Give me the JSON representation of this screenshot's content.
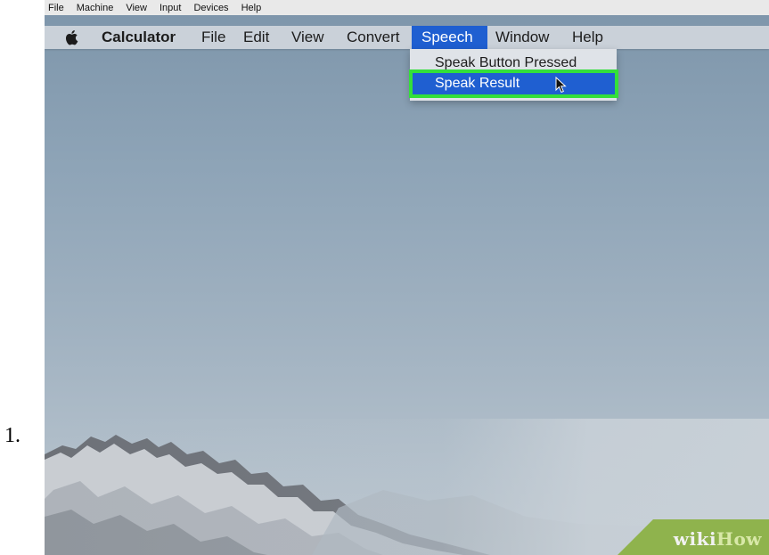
{
  "step": {
    "number": "1."
  },
  "vm_menubar": {
    "items": [
      "File",
      "Machine",
      "View",
      "Input",
      "Devices",
      "Help"
    ]
  },
  "mac_menubar": {
    "app_name": "Calculator",
    "items": [
      "File",
      "Edit",
      "View",
      "Convert",
      "Speech",
      "Window",
      "Help"
    ],
    "active_menu": "Speech"
  },
  "speech_menu": {
    "items": [
      "Speak Button Pressed",
      "Speak Result"
    ],
    "highlighted": "Speak Result"
  },
  "watermark": {
    "prefix": "wiki",
    "suffix": "How"
  },
  "colors": {
    "menu_highlight": "#1f5fd1",
    "annotation_box": "#33e03a",
    "watermark_bg": "#8fb34d"
  },
  "icons": {
    "apple": "apple-icon",
    "cursor": "cursor-icon"
  }
}
